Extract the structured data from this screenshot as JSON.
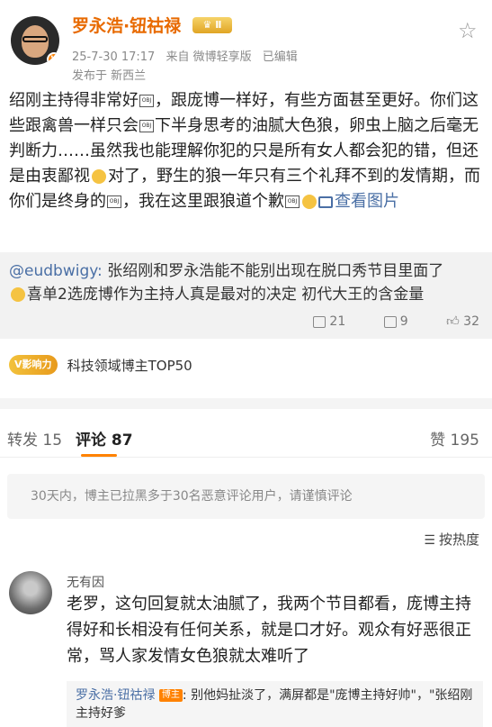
{
  "post": {
    "username": "罗永浩·钮祜禄",
    "level_badge": "Ⅱ",
    "date": "25-7-30 17:17",
    "source": "来自 微博轻享版",
    "edited": "已编辑",
    "location": "发布于 新西兰",
    "body_parts": [
      "绍刚主持得非常好",
      "，跟庞博一样好，有些方面甚至更好。你们这些跟禽兽一样只会",
      "下半身思考的油腻大色狼，卵虫上脑之后毫无判断力……虽然我也能理解你犯的只是所有女人都会犯的错，但还是由衷鄙视",
      "对了，野生的狼一年只有三个礼拜不到的发情期，而你们是终身的",
      "，我在这里跟狼道个歉",
      "查看图片"
    ],
    "obj_label": "OBJ"
  },
  "repost": {
    "handle": "@eudbwigy:",
    "text1": " 张绍刚和罗永浩能不能别出现在脱口秀节目里面了",
    "text2": "喜单2选庞博作为主持人真是最对的决定 初代大王的含金量",
    "reposts": "21",
    "comments": "9",
    "likes": "32"
  },
  "influence": {
    "badge": "V影响力",
    "text": "科技领域博主TOP50"
  },
  "tabs": {
    "repost": "转发 15",
    "comment": "评论 87",
    "like": "赞 195"
  },
  "notice": "30天内，博主已拉黑多于30名恶意评论用户，请谨慎评论",
  "sort": "按热度",
  "comment": {
    "user": "无有因",
    "text": "老罗，这句回复就太油腻了，我两个节目都看，庞博主持得好和长相没有任何关系，就是口才好。观众有好恶很正常，骂人家发情女色狼就太难听了",
    "reply_user": "罗永浩·钮祜禄",
    "reply_badge": "博主",
    "reply_text": ": 别他妈扯淡了，满屏都是\"庞博主持好帅\"，\"张绍刚主持好爹"
  }
}
